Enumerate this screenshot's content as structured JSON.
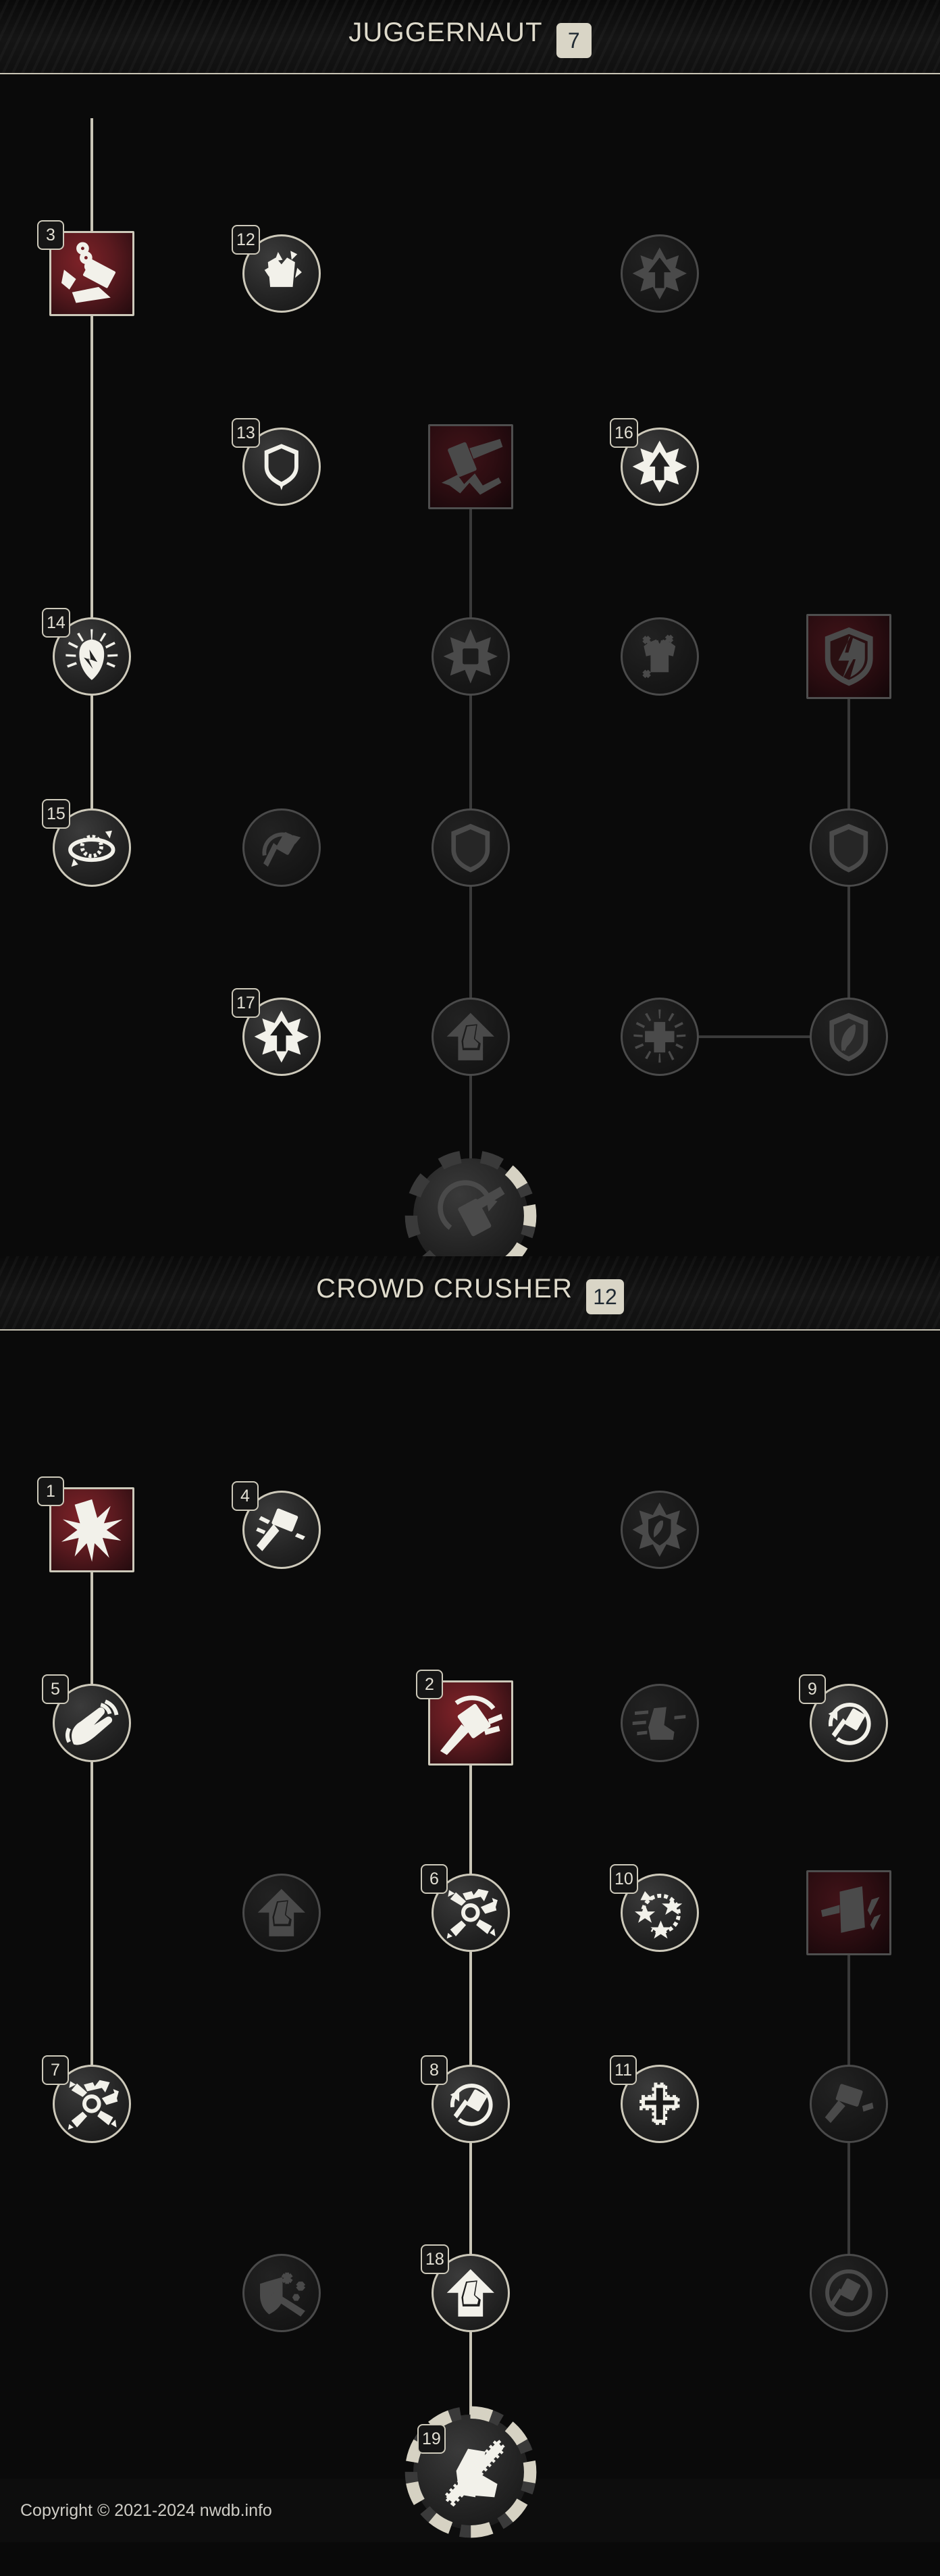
{
  "page": {
    "background_color": "#090909",
    "accent_color": "#c9c5b6",
    "ability_color": "#5b1a1f"
  },
  "trees": [
    {
      "id": "juggernaut",
      "title": "JUGGERNAUT",
      "points_badge": "7",
      "nodes": [
        {
          "rank": "3",
          "type": "ability",
          "state": "unlocked",
          "icon": "wrecking-ball-icon",
          "col": 1,
          "row": 1
        },
        {
          "rank": "12",
          "type": "passive",
          "state": "unlocked",
          "icon": "shattered-armor-icon",
          "col": 2,
          "row": 1
        },
        {
          "rank": "",
          "type": "passive",
          "state": "locked",
          "icon": "burst-up-arrow-icon",
          "col": 4,
          "row": 1
        },
        {
          "rank": "13",
          "type": "passive",
          "state": "unlocked",
          "icon": "shield-down-arrow-icon",
          "col": 2,
          "row": 2
        },
        {
          "rank": "",
          "type": "ability",
          "state": "locked",
          "icon": "hammer-crack-icon",
          "col": 3,
          "row": 2
        },
        {
          "rank": "16",
          "type": "passive",
          "state": "unlocked",
          "icon": "star-up-arrow-icon",
          "col": 4,
          "row": 2
        },
        {
          "rank": "14",
          "type": "passive",
          "state": "unlocked",
          "icon": "radiant-shield-icon",
          "col": 1,
          "row": 3
        },
        {
          "rank": "",
          "type": "passive",
          "state": "locked",
          "icon": "burst-star-icon",
          "col": 3,
          "row": 3
        },
        {
          "rank": "",
          "type": "passive",
          "state": "locked",
          "icon": "chest-armor-icon",
          "col": 4,
          "row": 3
        },
        {
          "rank": "",
          "type": "ability",
          "state": "locked",
          "icon": "broken-shield-icon",
          "col": 5,
          "row": 3
        },
        {
          "rank": "15",
          "type": "passive",
          "state": "unlocked",
          "icon": "orbit-ring-icon",
          "col": 1,
          "row": 4
        },
        {
          "rank": "",
          "type": "passive",
          "state": "locked",
          "icon": "hammer-arc-icon",
          "col": 2,
          "row": 4
        },
        {
          "rank": "",
          "type": "passive",
          "state": "locked",
          "icon": "shield-crest-icon",
          "col": 3,
          "row": 4
        },
        {
          "rank": "",
          "type": "passive",
          "state": "locked",
          "icon": "shield-crest-icon",
          "col": 5,
          "row": 4
        },
        {
          "rank": "17",
          "type": "passive",
          "state": "unlocked",
          "icon": "burst-up-arrow-icon",
          "col": 2,
          "row": 5
        },
        {
          "rank": "",
          "type": "passive",
          "state": "locked",
          "icon": "boot-up-arrow-icon",
          "col": 3,
          "row": 5
        },
        {
          "rank": "",
          "type": "passive",
          "state": "locked",
          "icon": "radiant-cross-icon",
          "col": 4,
          "row": 5
        },
        {
          "rank": "",
          "type": "passive",
          "state": "locked",
          "icon": "feather-shield-icon",
          "col": 5,
          "row": 5
        },
        {
          "rank": "",
          "type": "ultimate",
          "state": "partial",
          "icon": "hammer-spin-icon",
          "col": 3,
          "row": 6,
          "ring_progress": 55
        }
      ]
    },
    {
      "id": "crowd-crusher",
      "title": "CROWD CRUSHER",
      "points_badge": "12",
      "nodes": [
        {
          "rank": "1",
          "type": "ability",
          "state": "unlocked",
          "icon": "impact-burst-icon",
          "col": 1,
          "row": 1
        },
        {
          "rank": "4",
          "type": "passive",
          "state": "unlocked",
          "icon": "hammer-swing-icon",
          "col": 2,
          "row": 1
        },
        {
          "rank": "",
          "type": "passive",
          "state": "locked",
          "icon": "burst-shield-icon",
          "col": 4,
          "row": 1
        },
        {
          "rank": "5",
          "type": "passive",
          "state": "unlocked",
          "icon": "reaching-hand-icon",
          "col": 1,
          "row": 2
        },
        {
          "rank": "2",
          "type": "ability",
          "state": "unlocked",
          "icon": "hammer-throw-icon",
          "col": 3,
          "row": 2
        },
        {
          "rank": "",
          "type": "passive",
          "state": "locked",
          "icon": "swift-boot-icon",
          "col": 4,
          "row": 2
        },
        {
          "rank": "9",
          "type": "passive",
          "state": "unlocked",
          "icon": "hammer-cycle-icon",
          "col": 5,
          "row": 2
        },
        {
          "rank": "",
          "type": "passive",
          "state": "locked",
          "icon": "boot-up-arrow-icon",
          "col": 2,
          "row": 3
        },
        {
          "rank": "6",
          "type": "passive",
          "state": "unlocked",
          "icon": "burst-out-arrows-icon",
          "col": 3,
          "row": 3
        },
        {
          "rank": "10",
          "type": "passive",
          "state": "unlocked",
          "icon": "stars-cycle-icon",
          "col": 4,
          "row": 3
        },
        {
          "rank": "",
          "type": "ability",
          "state": "locked",
          "icon": "hammer-strike-icon",
          "col": 5,
          "row": 3
        },
        {
          "rank": "7",
          "type": "passive",
          "state": "unlocked",
          "icon": "burst-out-arrows-icon",
          "col": 1,
          "row": 4
        },
        {
          "rank": "8",
          "type": "passive",
          "state": "unlocked",
          "icon": "hammer-cycle-icon",
          "col": 3,
          "row": 4
        },
        {
          "rank": "11",
          "type": "passive",
          "state": "unlocked",
          "icon": "dashed-cross-icon",
          "col": 4,
          "row": 4
        },
        {
          "rank": "",
          "type": "passive",
          "state": "locked",
          "icon": "hammer-slam-icon",
          "col": 5,
          "row": 4
        },
        {
          "rank": "",
          "type": "passive",
          "state": "locked",
          "icon": "frost-shield-axe-icon",
          "col": 2,
          "row": 5
        },
        {
          "rank": "18",
          "type": "passive",
          "state": "unlocked",
          "icon": "boot-up-arrow-icon",
          "col": 3,
          "row": 5
        },
        {
          "rank": "",
          "type": "passive",
          "state": "locked",
          "icon": "hammer-circle-icon",
          "col": 5,
          "row": 5
        },
        {
          "rank": "19",
          "type": "ultimate",
          "state": "unlocked",
          "icon": "boot-strike-icon",
          "col": 3,
          "row": 6,
          "ring_progress": 100
        }
      ]
    }
  ],
  "footer": {
    "copyright": "Copyright © 2021-2024 nwdb.info"
  }
}
